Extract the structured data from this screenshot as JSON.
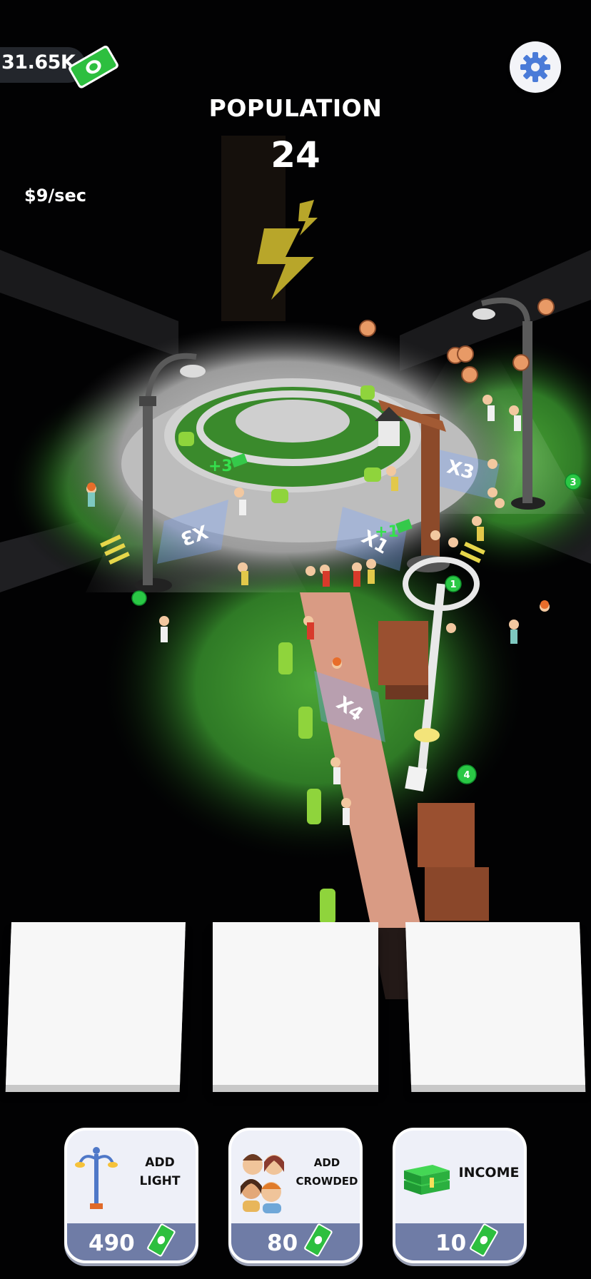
{
  "hud": {
    "money": "31.65K",
    "population_label": "POPULATION",
    "population_value": "24",
    "income_rate": "$9/sec"
  },
  "scene": {
    "multipliers": [
      "X3",
      "X3",
      "X1",
      "X4"
    ],
    "float_rewards": [
      "+3",
      "+1"
    ],
    "spot_badges": [
      "1",
      "3",
      "4"
    ]
  },
  "buttons": [
    {
      "label_line1": "ADD",
      "label_line2": "LIGHT",
      "price": "490",
      "icon": "street-lamp-icon"
    },
    {
      "label_line1": "ADD",
      "label_line2": "CROWDED",
      "price": "80",
      "icon": "people-group-icon"
    },
    {
      "label_line1": "INCOME",
      "label_line2": "",
      "price": "10",
      "icon": "cash-stack-icon"
    }
  ],
  "colors": {
    "background": "#020203",
    "grass": "#3a8a2c",
    "road": "#c9c9c9",
    "path": "#e3a58c",
    "button_footer": "#6f7ca6",
    "money_green": "#35c94a"
  }
}
